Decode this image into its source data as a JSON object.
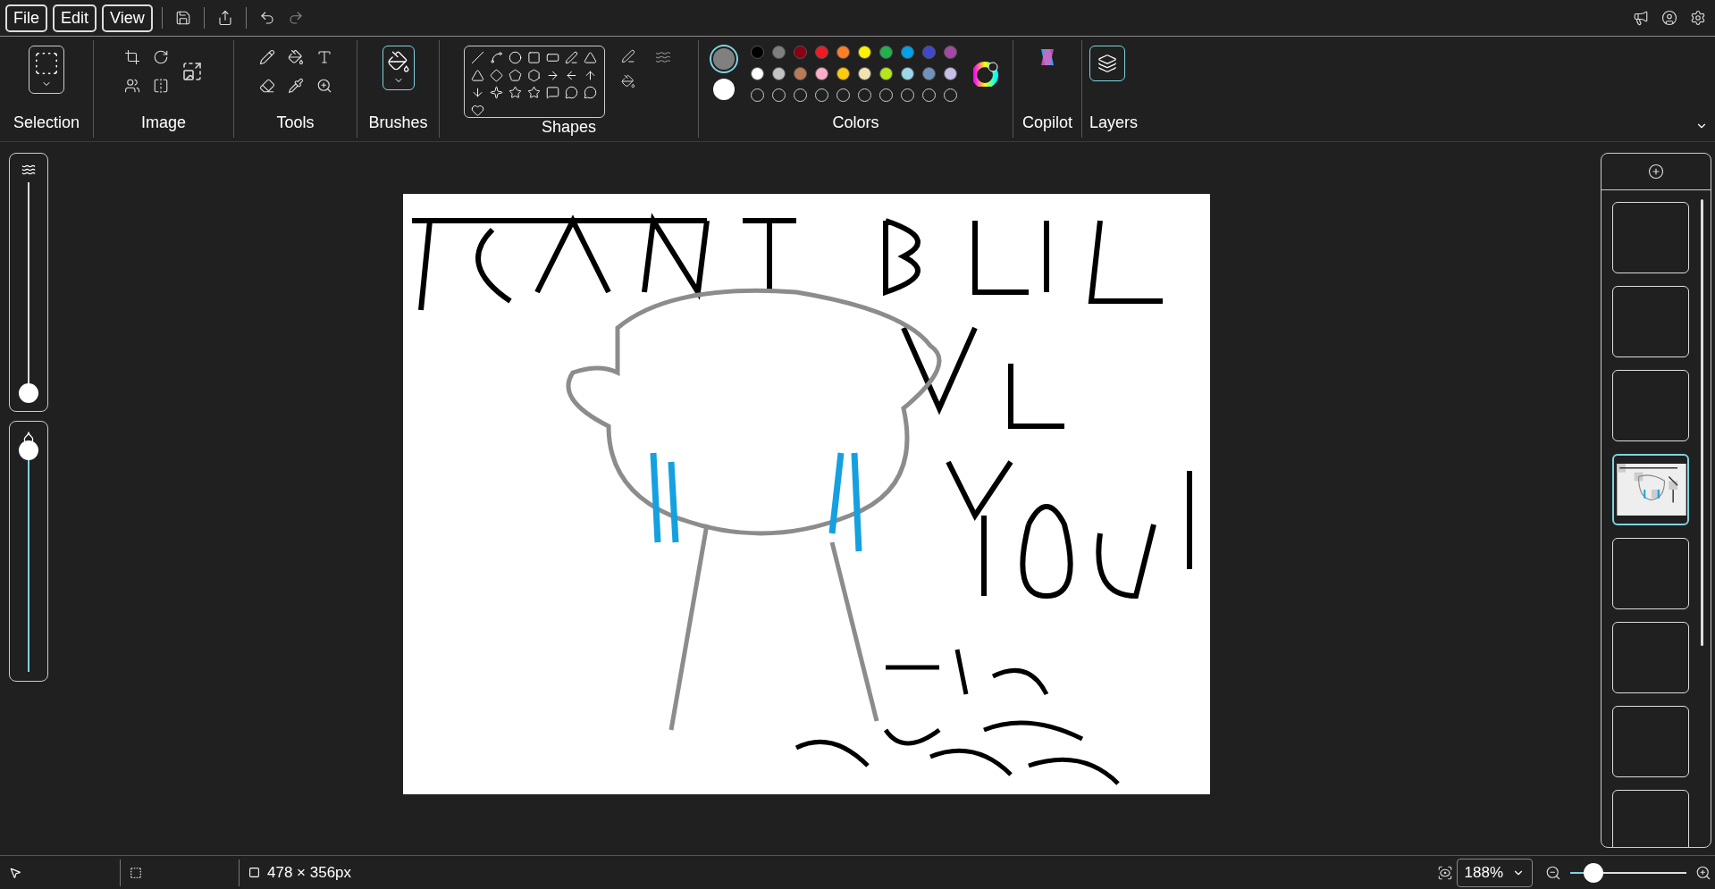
{
  "menu": [
    {
      "label": "File"
    },
    {
      "label": "Edit"
    },
    {
      "label": "View"
    }
  ],
  "ribbon": {
    "groups": [
      {
        "label": "Selection"
      },
      {
        "label": "Image"
      },
      {
        "label": "Tools"
      },
      {
        "label": "Brushes"
      },
      {
        "label": "Shapes"
      },
      {
        "label": "Colors"
      },
      {
        "label": "Copilot"
      },
      {
        "label": "Layers"
      }
    ]
  },
  "colors": {
    "primary": {
      "color": "#808080",
      "selected": true
    },
    "secondary": {
      "color": "#ffffff",
      "selected": false
    },
    "palette": [
      {
        "kind": "swatch",
        "color": "#000000"
      },
      {
        "kind": "swatch",
        "color": "#7f7f7f"
      },
      {
        "kind": "swatch",
        "color": "#880015"
      },
      {
        "kind": "swatch",
        "color": "#ed1c24"
      },
      {
        "kind": "swatch",
        "color": "#ff7f27"
      },
      {
        "kind": "swatch",
        "color": "#fff200"
      },
      {
        "kind": "swatch",
        "color": "#22b14c"
      },
      {
        "kind": "swatch",
        "color": "#00a2e8"
      },
      {
        "kind": "swatch",
        "color": "#3f48cc"
      },
      {
        "kind": "swatch",
        "color": "#a349a4"
      },
      {
        "kind": "swatch",
        "color": "#ffffff"
      },
      {
        "kind": "swatch",
        "color": "#c3c3c3"
      },
      {
        "kind": "swatch",
        "color": "#b97a57"
      },
      {
        "kind": "swatch",
        "color": "#ffaec9"
      },
      {
        "kind": "swatch",
        "color": "#ffc90e"
      },
      {
        "kind": "swatch",
        "color": "#efe4b0"
      },
      {
        "kind": "swatch",
        "color": "#b5e61d"
      },
      {
        "kind": "swatch",
        "color": "#99d9ea"
      },
      {
        "kind": "swatch",
        "color": "#7092be"
      },
      {
        "kind": "swatch",
        "color": "#c8bfe7"
      },
      {
        "kind": "empty"
      },
      {
        "kind": "empty"
      },
      {
        "kind": "empty"
      },
      {
        "kind": "empty"
      },
      {
        "kind": "empty"
      },
      {
        "kind": "empty"
      },
      {
        "kind": "empty"
      },
      {
        "kind": "empty"
      },
      {
        "kind": "empty"
      },
      {
        "kind": "empty"
      }
    ]
  },
  "sliders": [
    {
      "kind": "size",
      "level": 0.04
    },
    {
      "kind": "opacity",
      "level": 1
    }
  ],
  "canvas": {
    "kind": "picture"
  },
  "layers": [
    {
      "selected": false,
      "kind": "empty"
    },
    {
      "selected": false,
      "kind": "empty"
    },
    {
      "selected": false,
      "kind": "empty"
    },
    {
      "selected": true,
      "kind": "picture"
    },
    {
      "selected": false,
      "kind": "empty"
    },
    {
      "selected": false,
      "kind": "empty"
    },
    {
      "selected": false,
      "kind": "empty"
    },
    {
      "selected": false,
      "kind": "empty"
    }
  ],
  "status_bar": {
    "canvas_size": "478 × 356px",
    "zoom": "188%",
    "zoom_slider": {
      "level": 0.2
    }
  }
}
